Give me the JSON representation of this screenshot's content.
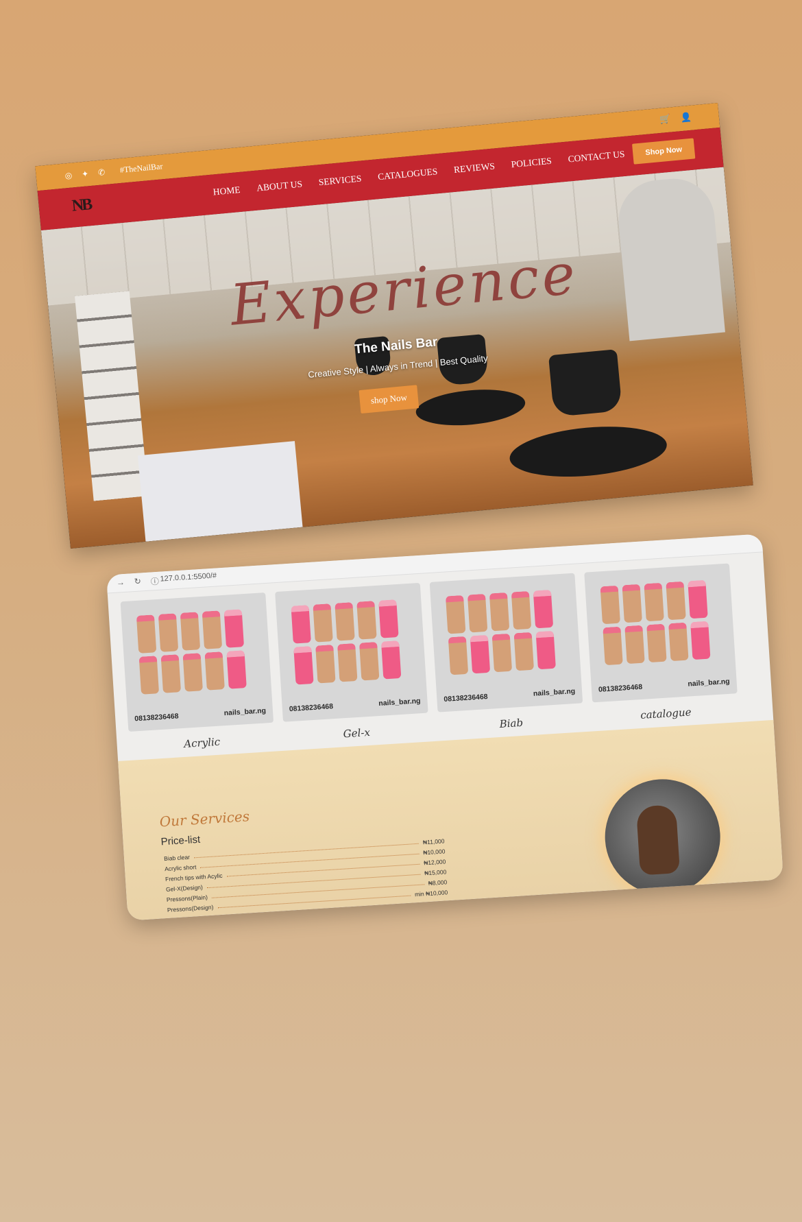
{
  "site": {
    "hashtag": "#TheNailBar",
    "logo": "NB",
    "nav": [
      "HOME",
      "ABOUT US",
      "SERVICES",
      "CATALOGUES",
      "REVIEWS",
      "POLICIES",
      "CONTACT US"
    ],
    "shop_now": "Shop Now",
    "icons": {
      "social": [
        "instagram-icon",
        "twitter-icon",
        "whatsapp-icon"
      ],
      "right": [
        "cart-icon",
        "user-icon"
      ]
    }
  },
  "hero": {
    "title": "Experience",
    "subtitle": "The Nails Bar",
    "tagline": "Creative Style | Always in Trend | Best Quality",
    "cta": "shop Now"
  },
  "browser": {
    "url": "127.0.0.1:5500/#"
  },
  "catalogue": {
    "phone": "08138236468",
    "handle": "nails_bar.ng",
    "cards": [
      {
        "label": "Acrylic"
      },
      {
        "label": "Gel-x"
      },
      {
        "label": "Biab"
      },
      {
        "label": "catalogue"
      }
    ]
  },
  "services": {
    "heading": "Our Services",
    "price_list_title": "Price-list",
    "items": [
      {
        "name": "Biab clear",
        "price": "₦11,000"
      },
      {
        "name": "Acrylic short",
        "price": "₦10,000"
      },
      {
        "name": "French tips with Acylic",
        "price": "₦12,000"
      },
      {
        "name": "Gel-X(Design)",
        "price": "₦15,000"
      },
      {
        "name": "Pressons(Plain)",
        "price": "₦8,000"
      },
      {
        "name": "Pressons(Design)",
        "price": "min ₦10,000"
      }
    ]
  },
  "colors": {
    "orange": "#e49a3c",
    "red": "#c3262f",
    "accent": "#e8923d"
  }
}
